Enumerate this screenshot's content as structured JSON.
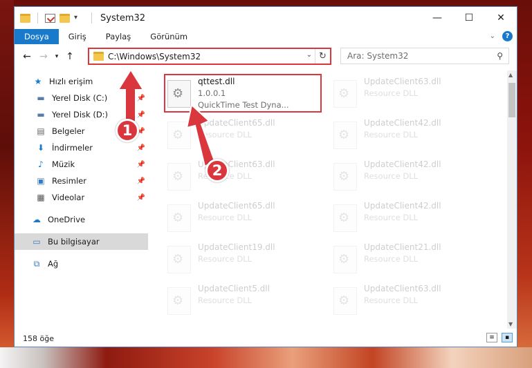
{
  "window": {
    "title": "System32"
  },
  "controls": {
    "minimize": "—",
    "maximize": "☐",
    "close": "✕"
  },
  "ribbon": {
    "tabs": [
      "Dosya",
      "Giriş",
      "Paylaş",
      "Görünüm"
    ]
  },
  "address": {
    "path": "C:\\Windows\\System32"
  },
  "search": {
    "placeholder": "Ara: System32"
  },
  "sidebar": {
    "items": [
      {
        "label": "Hızlı erişim"
      },
      {
        "label": "Yerel Disk (C:)"
      },
      {
        "label": "Yerel Disk (D:)"
      },
      {
        "label": "Belgeler"
      },
      {
        "label": "İndirmeler"
      },
      {
        "label": "Müzik"
      },
      {
        "label": "Resimler"
      },
      {
        "label": "Videolar"
      },
      {
        "label": "OneDrive"
      },
      {
        "label": "Bu bilgisayar"
      },
      {
        "label": "Ağ"
      }
    ]
  },
  "files": [
    {
      "name": "qttest.dll",
      "line2": "1.0.0.1",
      "line3": "QuickTime Test Dyna..."
    },
    {
      "name": "UpdateClient63.dll",
      "line2": "Resource DLL"
    },
    {
      "name": "UpdateClient65.dll",
      "line2": "Resource DLL"
    },
    {
      "name": "UpdateClient42.dll",
      "line2": "Resource DLL"
    },
    {
      "name": "UpdateClient63.dll",
      "line2": "Resource DLL"
    },
    {
      "name": "UpdateClient42.dll",
      "line2": "Resource DLL"
    },
    {
      "name": "UpdateClient65.dll",
      "line2": "Resource DLL"
    },
    {
      "name": "UpdateClient42.dll",
      "line2": "Resource DLL"
    },
    {
      "name": "UpdateClient19.dll",
      "line2": "Resource DLL"
    },
    {
      "name": "UpdateClient21.dll",
      "line2": "Resource DLL"
    },
    {
      "name": "UpdateClient5.dll",
      "line2": "Resource DLL"
    },
    {
      "name": "UpdateClient63.dll",
      "line2": "Resource DLL"
    }
  ],
  "status": {
    "count": "158 öğe"
  },
  "annotations": [
    "1",
    "2"
  ],
  "colors": {
    "accent": "#1979ca",
    "highlight": "#d9363e"
  }
}
